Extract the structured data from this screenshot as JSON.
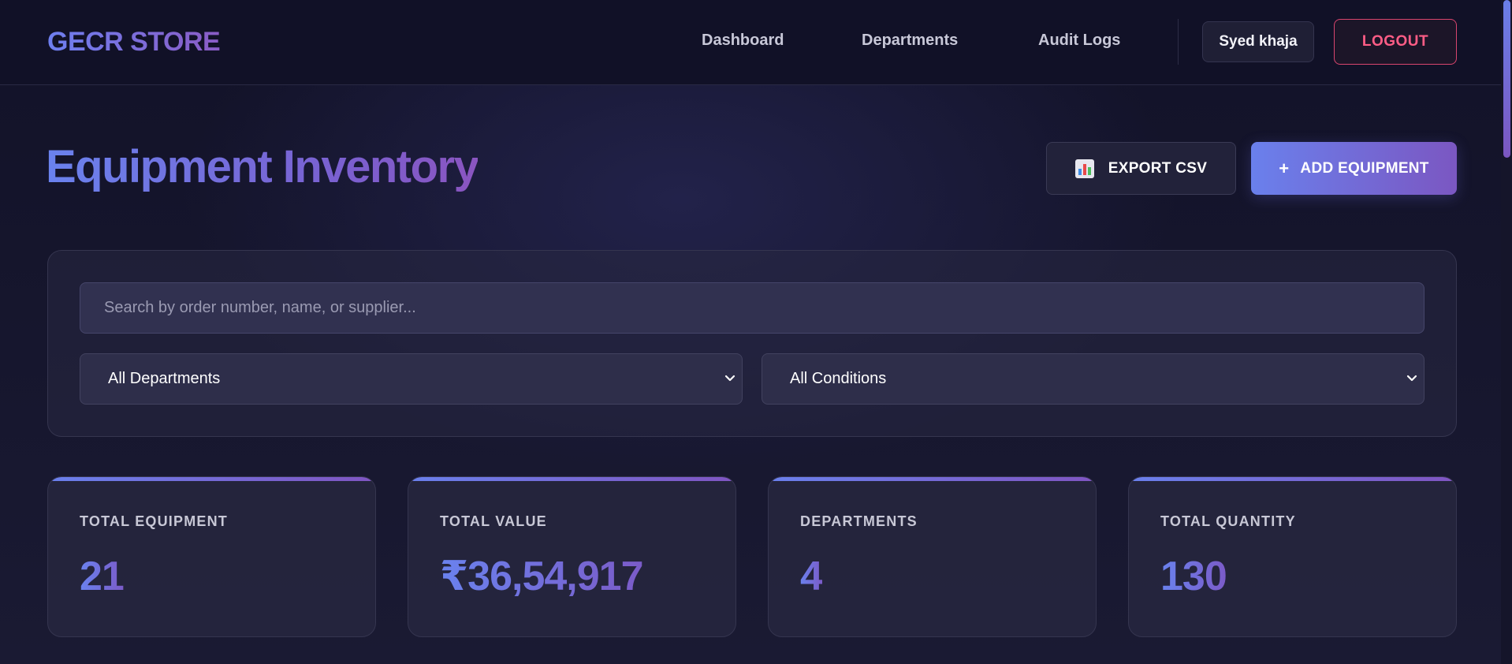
{
  "header": {
    "brand": "GECR STORE",
    "nav": [
      "Dashboard",
      "Departments",
      "Audit Logs"
    ],
    "user_name": "Syed khaja",
    "logout_label": "LOGOUT"
  },
  "page": {
    "title": "Equipment Inventory",
    "export_label": "EXPORT CSV",
    "add_icon": "+",
    "add_label": "ADD EQUIPMENT"
  },
  "filters": {
    "search_placeholder": "Search by order number, name, or supplier...",
    "department_selected": "All Departments",
    "condition_selected": "All Conditions"
  },
  "stats": [
    {
      "label": "TOTAL EQUIPMENT",
      "value": "21"
    },
    {
      "label": "TOTAL VALUE",
      "value": "₹36,54,917"
    },
    {
      "label": "DEPARTMENTS",
      "value": "4"
    },
    {
      "label": "TOTAL QUANTITY",
      "value": "130"
    }
  ],
  "colors": {
    "accent_start": "#6a80ec",
    "accent_end": "#7b57c2",
    "danger": "#ff5d86",
    "background": "#14142a"
  },
  "icons": {
    "export": "bar-chart-icon",
    "add": "plus-icon",
    "select": "chevron-down-icon"
  }
}
